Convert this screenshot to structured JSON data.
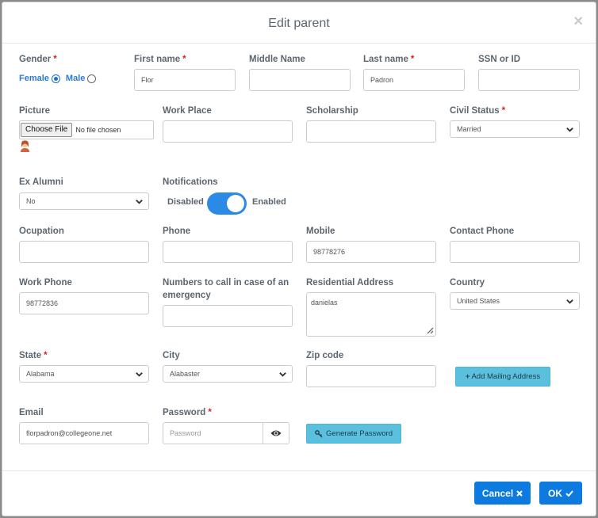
{
  "modal": {
    "title": "Edit parent",
    "close_symbol": "×"
  },
  "fields": {
    "gender": {
      "label": "Gender",
      "female_label": "Female",
      "male_label": "Male",
      "selected": "Female"
    },
    "first_name": {
      "label": "First name",
      "value": "Flor"
    },
    "middle_name": {
      "label": "Middle Name",
      "value": ""
    },
    "last_name": {
      "label": "Last name",
      "value": "Padron"
    },
    "ssn": {
      "label": "SSN or ID",
      "value": ""
    },
    "picture": {
      "label": "Picture",
      "button": "Choose File",
      "status": "No file chosen"
    },
    "work_place": {
      "label": "Work Place",
      "value": ""
    },
    "scholarship": {
      "label": "Scholarship",
      "value": ""
    },
    "civil_status": {
      "label": "Civil Status",
      "value": "Married"
    },
    "ex_alumni": {
      "label": "Ex Alumni",
      "value": "No"
    },
    "notifications": {
      "label": "Notifications",
      "off_label": "Disabled",
      "on_label": "Enabled",
      "enabled": true
    },
    "occupation": {
      "label": "Ocupation",
      "value": ""
    },
    "phone": {
      "label": "Phone",
      "value": ""
    },
    "mobile": {
      "label": "Mobile",
      "value": "98778276"
    },
    "contact_phone": {
      "label": "Contact Phone",
      "value": ""
    },
    "work_phone": {
      "label": "Work Phone",
      "value": "98772836"
    },
    "emergency": {
      "label_line1": "Numbers to call in case of an",
      "label_line2": "emergency",
      "value": ""
    },
    "residential_address": {
      "label": "Residential Address",
      "value": "danielas"
    },
    "country": {
      "label": "Country",
      "value": "United States"
    },
    "state": {
      "label": "State",
      "value": "Alabama"
    },
    "city": {
      "label": "City",
      "value": "Alabaster"
    },
    "zip": {
      "label": "Zip code",
      "value": ""
    },
    "mailing_button": {
      "label": "Add Mailing Address"
    },
    "email": {
      "label": "Email",
      "value": "florpadron@collegeone.net"
    },
    "password": {
      "label": "Password",
      "placeholder": "Password"
    },
    "generate_button": {
      "label": "Generate Password"
    }
  },
  "required_mark": "*",
  "footer": {
    "cancel": "Cancel",
    "ok": "OK"
  },
  "colors": {
    "primary": "#0d7ae0",
    "info": "#5bc0de",
    "required": "#e02020",
    "toggle": "#2b8ae6"
  }
}
